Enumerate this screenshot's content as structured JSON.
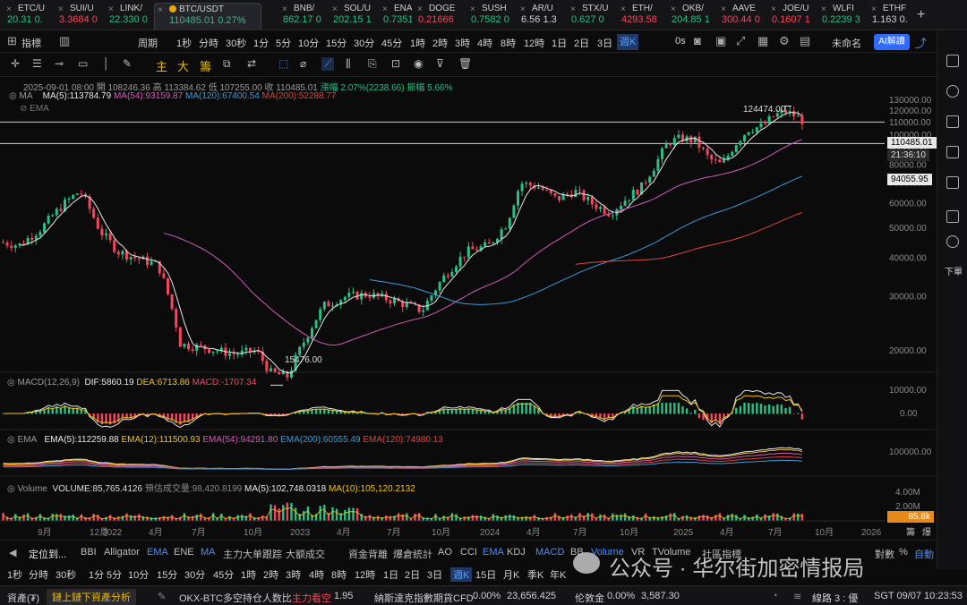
{
  "tickers": [
    {
      "symbol": "ETC/U",
      "price": "20.31 0.",
      "color": "#2ebd85",
      "active": false
    },
    {
      "symbol": "SUI/U",
      "price": "3.3684 0",
      "color": "#f6465d",
      "active": false
    },
    {
      "symbol": "LINK/",
      "price": "22.330 0",
      "color": "#2ebd85",
      "active": false
    },
    {
      "symbol": "BTC/USDT",
      "price": "110485.01 0.27%",
      "color": "#2ebd85",
      "active": true
    },
    {
      "symbol": "BNB/",
      "price": "862.17 0",
      "color": "#2ebd85",
      "active": false
    },
    {
      "symbol": "SOL/U",
      "price": "202.15 1",
      "color": "#2ebd85",
      "active": false
    },
    {
      "symbol": "ENA/",
      "price": "0.7351 -",
      "color": "#2ebd85",
      "active": false
    },
    {
      "symbol": "DOGE",
      "price": "0.21666",
      "color": "#f6465d",
      "active": false
    },
    {
      "symbol": "SUSH",
      "price": "0.7582 0",
      "color": "#2ebd85",
      "active": false
    },
    {
      "symbol": "AR/U",
      "price": "6.56 1.3",
      "color": "#cfcfcf",
      "active": false
    },
    {
      "symbol": "STX/U",
      "price": "0.627 0",
      "color": "#2ebd85",
      "active": false
    },
    {
      "symbol": "ETH/",
      "price": "4293.58",
      "color": "#f6465d",
      "active": false
    },
    {
      "symbol": "OKB/",
      "price": "204.85 1",
      "color": "#2ebd85",
      "active": false
    },
    {
      "symbol": "AAVE",
      "price": "300.44 0",
      "color": "#f6465d",
      "active": false
    },
    {
      "symbol": "JOE/U",
      "price": "0.1607 1",
      "color": "#f6465d",
      "active": false
    },
    {
      "symbol": "WLFI",
      "price": "0.2239 3",
      "color": "#2ebd85",
      "active": false
    },
    {
      "symbol": "ETHF",
      "price": "1.163 0.",
      "color": "#cfcfcf",
      "active": false
    }
  ],
  "toolbar1": {
    "items": [
      "指標",
      "周期",
      "1秒",
      "分時",
      "30秒",
      "1分",
      "5分",
      "10分",
      "15分",
      "30分",
      "45分",
      "1時",
      "2時",
      "3時",
      "4時",
      "8時",
      "12時",
      "1日",
      "2日",
      "3日",
      "週K"
    ],
    "selected": "週K",
    "zero_s": "0s",
    "unnamed": "未命名",
    "ai": "AI解讀"
  },
  "toolbar2": {
    "zhu": "主",
    "da": "大",
    "chou": "籌"
  },
  "sidebar": {
    "xiadan": "下單"
  },
  "info": {
    "date": "2025-09-01 08:00",
    "open": "開 108246.36",
    "high": "高 113384.62",
    "low": "低 107255.00",
    "close": "收 110485.01",
    "change": "漲幅 2.07%(2238.66)",
    "amp": "振幅 5.66%"
  },
  "ma": {
    "title": "MA",
    "ma5": "MA(5):113784.79",
    "ma54": "MA(54):93159.87",
    "ma120": "MA(120):67400.54",
    "ma200": "MA(200):52288.77",
    "ema": "EMA"
  },
  "price_axis": [
    "130000.00",
    "120000.00",
    "110000.00",
    "100000.00",
    "90000.00",
    "80000.00",
    "70000.00",
    "60000.00",
    "50000.00",
    "40000.00",
    "30000.00",
    "20000.00"
  ],
  "price_tags": {
    "current": "110485.01",
    "countdown": "21:36:10",
    "line2": "94055.95",
    "high": "124474.00",
    "low": "15476.00"
  },
  "macd": {
    "title": "MACD(12,26,9)",
    "dif": "DIF:5860.19",
    "dea": "DEA:6713.86",
    "macd": "MACD:-1707.34",
    "axis_top": "10000.00",
    "axis_zero": "0.00"
  },
  "ema": {
    "title": "EMA",
    "e5": "EMA(5):112259.88",
    "e12": "EMA(12):111500.93",
    "e54": "EMA(54):94291.80",
    "e200": "EMA(200):60555.49",
    "e120": "EMA(120):74980.13",
    "axis": "100000.00"
  },
  "volume": {
    "title": "Volume",
    "vol": "VOLUME:85,765.4126",
    "est": "預估成交量:98,420.8199",
    "ma5": "MA(5):102,748.0318",
    "ma10": "MA(10):105,120.2132",
    "axis1": "4.00M",
    "axis2": "2.00M",
    "tag": "85.8k"
  },
  "time_axis": [
    "9月",
    "12月",
    "2022",
    "4月",
    "7月",
    "10月",
    "2023",
    "4月",
    "7月",
    "10月",
    "2024",
    "4月",
    "7月",
    "10月",
    "2025",
    "4月",
    "7月",
    "10月",
    "2026"
  ],
  "chou_bao": [
    "籌",
    "爆"
  ],
  "bottom1": {
    "items": [
      "定位到...",
      "BBI",
      "Alligator",
      "EMA",
      "ENE",
      "MA",
      "主力大单跟踪",
      "大额成交",
      "資金背離",
      "爆倉統計",
      "AO",
      "CCI",
      "EMA",
      "KDJ",
      "MACD",
      "BB",
      "Volume",
      "VR",
      "TVolume",
      "社區指標",
      "對數",
      "%",
      "自動"
    ]
  },
  "bottom2": {
    "items": [
      "1秒",
      "分時",
      "30秒",
      "1分",
      "5分",
      "10分",
      "15分",
      "30分",
      "45分",
      "1時",
      "2時",
      "3時",
      "4時",
      "8時",
      "12時",
      "1日",
      "2日",
      "3日",
      "週K",
      "15日",
      "月K",
      "季K",
      "年K"
    ]
  },
  "watermark": "公众号 · 华尔街加密情报局",
  "status": {
    "assets": "資產(₮)",
    "analysis": "鏈上鏈下資產分析",
    "okx": "OKX-BTC多空持仓人数比",
    "okx_tag": "主力看空",
    "okx_val": "1.95",
    "nasdaq": "納斯達克指數期貨CFD",
    "nasdaq_pct": "0.00%",
    "nasdaq_val": "23,656.425",
    "gold": "伦敦金",
    "gold_pct": "0.00%",
    "gold_val": "3,587.30",
    "line": "線路 3 : 優",
    "time": "SGT 09/07 10:23:53"
  }
}
